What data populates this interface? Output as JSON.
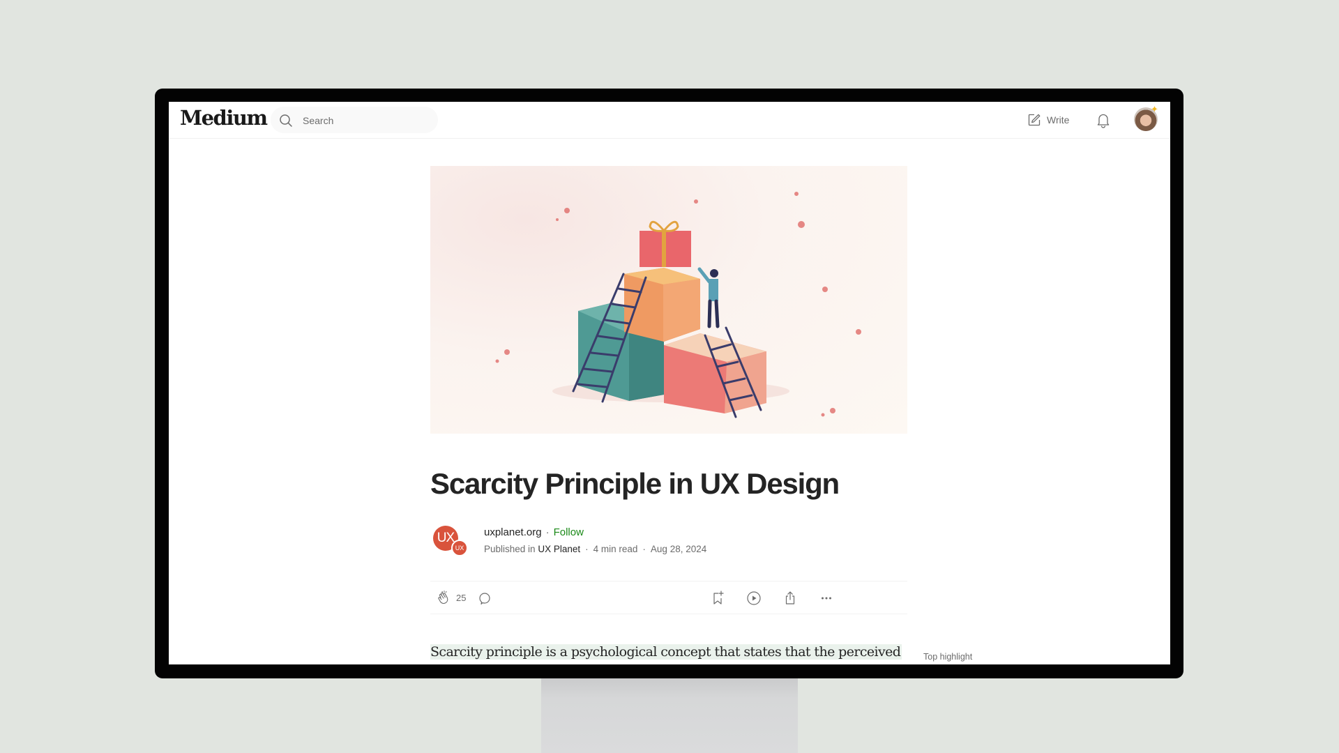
{
  "app": {
    "logo": "Medium",
    "search": {
      "placeholder": "Search",
      "value": ""
    },
    "write_label": "Write",
    "icons": {
      "search": "search-icon",
      "write": "pencil-square-icon",
      "notifications": "bell-icon",
      "profile": "avatar"
    }
  },
  "article": {
    "hero_image": {
      "description": "Illustration of a person climbing stacked teal, orange and pink blocks with ladders reaching for a gift box",
      "colors": {
        "teal": "#4f9a94",
        "orange": "#ef9a62",
        "pink": "#ec7a76",
        "gift": "#e9666b",
        "ribbon": "#e2a33f",
        "ladder": "#3a3c6b",
        "person_shirt": "#5aa0b5"
      }
    },
    "title": "Scarcity Principle in UX Design",
    "publication_avatar": {
      "main": "UX",
      "badge": "UX",
      "color": "#d9533c"
    },
    "author": "uxplanet.org",
    "follow_label": "Follow",
    "published_prefix": "Published in",
    "publication": "UX Planet",
    "read_time": "4 min read",
    "date": "Aug 28, 2024",
    "separator": "·",
    "actions": {
      "clap_count": "25",
      "icons": [
        "clap-icon",
        "comment-icon",
        "bookmark-add-icon",
        "play-listen-icon",
        "share-icon",
        "more-icon"
      ]
    },
    "first_paragraph": "Scarcity principle is a psychological concept that states that the perceived",
    "top_highlight_label": "Top highlight"
  },
  "colors": {
    "background": "#e1e5e0",
    "follow_green": "#1a8917",
    "highlight_bg": "#eaf2ec",
    "text_primary": "#242424",
    "text_secondary": "#6b6b6b"
  }
}
